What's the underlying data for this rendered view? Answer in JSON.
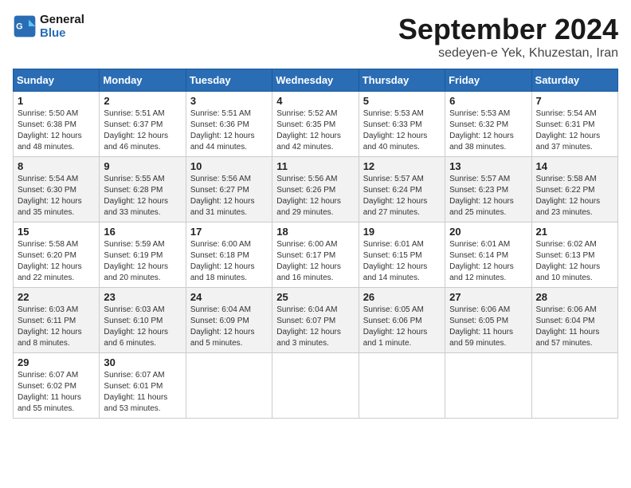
{
  "header": {
    "logo_line1": "General",
    "logo_line2": "Blue",
    "month": "September 2024",
    "location": "sedeyen-e Yek, Khuzestan, Iran"
  },
  "weekdays": [
    "Sunday",
    "Monday",
    "Tuesday",
    "Wednesday",
    "Thursday",
    "Friday",
    "Saturday"
  ],
  "weeks": [
    [
      {
        "day": 1,
        "info": "Sunrise: 5:50 AM\nSunset: 6:38 PM\nDaylight: 12 hours\nand 48 minutes."
      },
      {
        "day": 2,
        "info": "Sunrise: 5:51 AM\nSunset: 6:37 PM\nDaylight: 12 hours\nand 46 minutes."
      },
      {
        "day": 3,
        "info": "Sunrise: 5:51 AM\nSunset: 6:36 PM\nDaylight: 12 hours\nand 44 minutes."
      },
      {
        "day": 4,
        "info": "Sunrise: 5:52 AM\nSunset: 6:35 PM\nDaylight: 12 hours\nand 42 minutes."
      },
      {
        "day": 5,
        "info": "Sunrise: 5:53 AM\nSunset: 6:33 PM\nDaylight: 12 hours\nand 40 minutes."
      },
      {
        "day": 6,
        "info": "Sunrise: 5:53 AM\nSunset: 6:32 PM\nDaylight: 12 hours\nand 38 minutes."
      },
      {
        "day": 7,
        "info": "Sunrise: 5:54 AM\nSunset: 6:31 PM\nDaylight: 12 hours\nand 37 minutes."
      }
    ],
    [
      {
        "day": 8,
        "info": "Sunrise: 5:54 AM\nSunset: 6:30 PM\nDaylight: 12 hours\nand 35 minutes."
      },
      {
        "day": 9,
        "info": "Sunrise: 5:55 AM\nSunset: 6:28 PM\nDaylight: 12 hours\nand 33 minutes."
      },
      {
        "day": 10,
        "info": "Sunrise: 5:56 AM\nSunset: 6:27 PM\nDaylight: 12 hours\nand 31 minutes."
      },
      {
        "day": 11,
        "info": "Sunrise: 5:56 AM\nSunset: 6:26 PM\nDaylight: 12 hours\nand 29 minutes."
      },
      {
        "day": 12,
        "info": "Sunrise: 5:57 AM\nSunset: 6:24 PM\nDaylight: 12 hours\nand 27 minutes."
      },
      {
        "day": 13,
        "info": "Sunrise: 5:57 AM\nSunset: 6:23 PM\nDaylight: 12 hours\nand 25 minutes."
      },
      {
        "day": 14,
        "info": "Sunrise: 5:58 AM\nSunset: 6:22 PM\nDaylight: 12 hours\nand 23 minutes."
      }
    ],
    [
      {
        "day": 15,
        "info": "Sunrise: 5:58 AM\nSunset: 6:20 PM\nDaylight: 12 hours\nand 22 minutes."
      },
      {
        "day": 16,
        "info": "Sunrise: 5:59 AM\nSunset: 6:19 PM\nDaylight: 12 hours\nand 20 minutes."
      },
      {
        "day": 17,
        "info": "Sunrise: 6:00 AM\nSunset: 6:18 PM\nDaylight: 12 hours\nand 18 minutes."
      },
      {
        "day": 18,
        "info": "Sunrise: 6:00 AM\nSunset: 6:17 PM\nDaylight: 12 hours\nand 16 minutes."
      },
      {
        "day": 19,
        "info": "Sunrise: 6:01 AM\nSunset: 6:15 PM\nDaylight: 12 hours\nand 14 minutes."
      },
      {
        "day": 20,
        "info": "Sunrise: 6:01 AM\nSunset: 6:14 PM\nDaylight: 12 hours\nand 12 minutes."
      },
      {
        "day": 21,
        "info": "Sunrise: 6:02 AM\nSunset: 6:13 PM\nDaylight: 12 hours\nand 10 minutes."
      }
    ],
    [
      {
        "day": 22,
        "info": "Sunrise: 6:03 AM\nSunset: 6:11 PM\nDaylight: 12 hours\nand 8 minutes."
      },
      {
        "day": 23,
        "info": "Sunrise: 6:03 AM\nSunset: 6:10 PM\nDaylight: 12 hours\nand 6 minutes."
      },
      {
        "day": 24,
        "info": "Sunrise: 6:04 AM\nSunset: 6:09 PM\nDaylight: 12 hours\nand 5 minutes."
      },
      {
        "day": 25,
        "info": "Sunrise: 6:04 AM\nSunset: 6:07 PM\nDaylight: 12 hours\nand 3 minutes."
      },
      {
        "day": 26,
        "info": "Sunrise: 6:05 AM\nSunset: 6:06 PM\nDaylight: 12 hours\nand 1 minute."
      },
      {
        "day": 27,
        "info": "Sunrise: 6:06 AM\nSunset: 6:05 PM\nDaylight: 11 hours\nand 59 minutes."
      },
      {
        "day": 28,
        "info": "Sunrise: 6:06 AM\nSunset: 6:04 PM\nDaylight: 11 hours\nand 57 minutes."
      }
    ],
    [
      {
        "day": 29,
        "info": "Sunrise: 6:07 AM\nSunset: 6:02 PM\nDaylight: 11 hours\nand 55 minutes."
      },
      {
        "day": 30,
        "info": "Sunrise: 6:07 AM\nSunset: 6:01 PM\nDaylight: 11 hours\nand 53 minutes."
      },
      null,
      null,
      null,
      null,
      null
    ]
  ]
}
